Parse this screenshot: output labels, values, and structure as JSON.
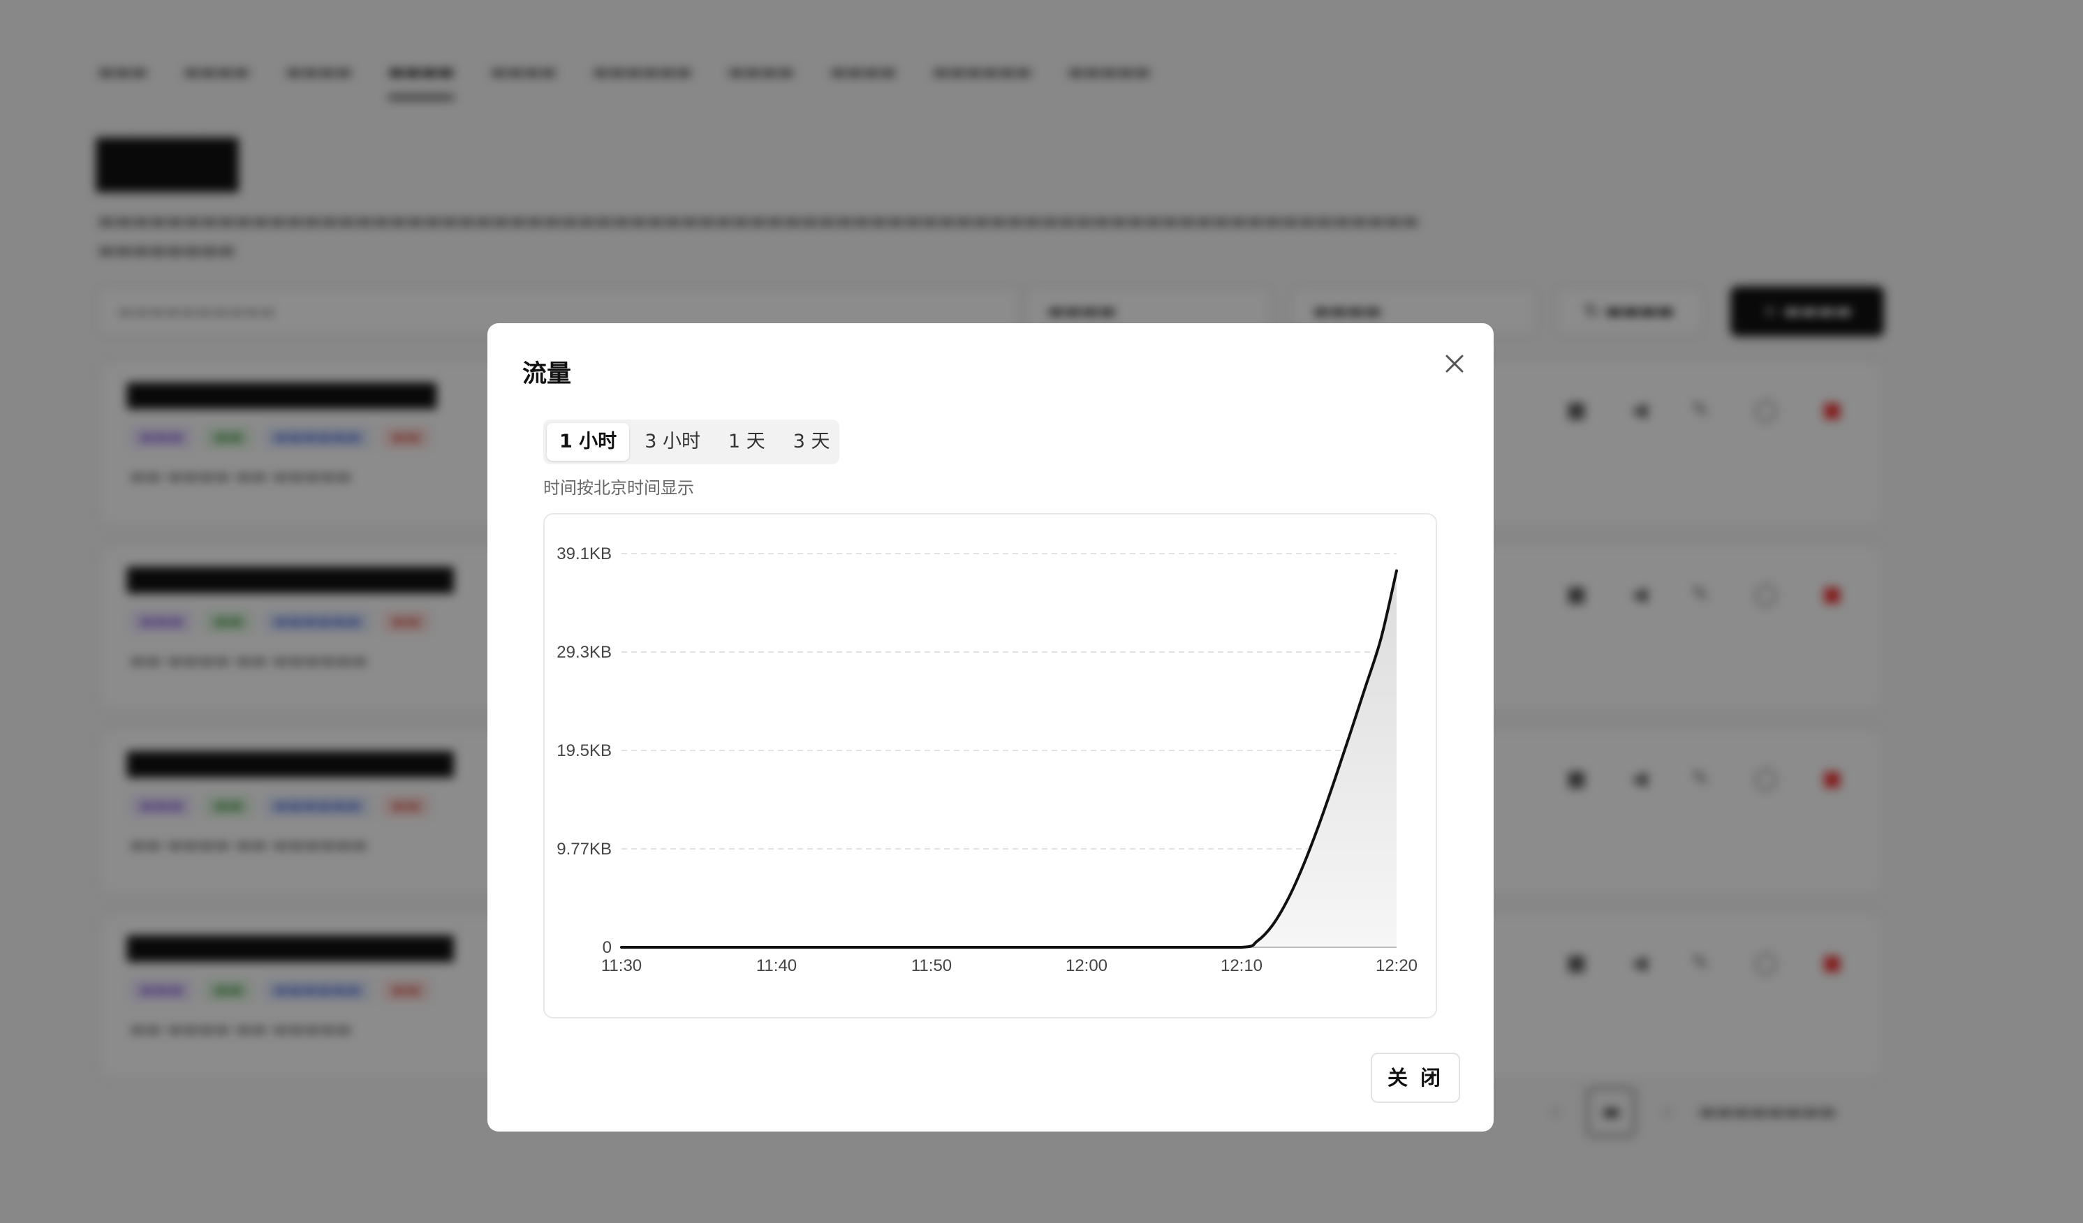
{
  "modal": {
    "title": "流量",
    "close_label": "关 闭",
    "tabs": [
      "1 小时",
      "3 小时",
      "1 天",
      "3 天"
    ],
    "active_tab": 0,
    "hint": "时间按北京时间显示"
  },
  "chart_data": {
    "type": "area",
    "title": "",
    "xlabel": "",
    "ylabel": "",
    "x_ticks": [
      "11:30",
      "11:40",
      "11:50",
      "12:00",
      "12:10",
      "12:20"
    ],
    "y_ticks": [
      "0",
      "9.77KB",
      "19.5KB",
      "29.3KB",
      "39.1KB"
    ],
    "ylim": [
      0,
      39.1
    ],
    "y_unit": "KB",
    "grid": true,
    "series": [
      {
        "x": [
          "11:30",
          "11:35",
          "11:40",
          "11:45",
          "11:50",
          "11:55",
          "12:00",
          "12:05",
          "12:10",
          "12:11",
          "12:12",
          "12:13",
          "12:14",
          "12:15",
          "12:16",
          "12:17",
          "12:18",
          "12:19",
          "12:20"
        ],
        "values": [
          0,
          0,
          0,
          0,
          0,
          0,
          0,
          0,
          0,
          0.6,
          2.2,
          4.8,
          8.2,
          12.2,
          16.6,
          21.2,
          25.9,
          30.7,
          37.4
        ]
      }
    ],
    "colors": {
      "line": "#111111",
      "fill_top": "#dcdcdc",
      "fill_bottom": "#f6f6f6"
    }
  }
}
